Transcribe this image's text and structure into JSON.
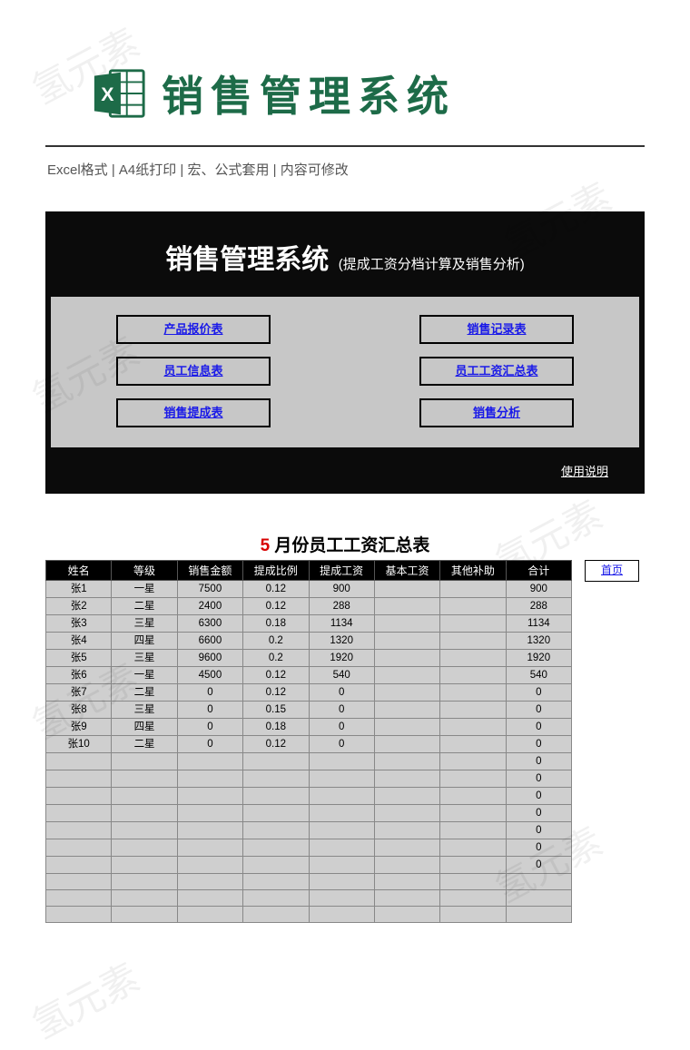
{
  "watermark_text": "氢元素",
  "header": {
    "title": "销售管理系统",
    "features": "Excel格式 |  A4纸打印 | 宏、公式套用 | 内容可修改"
  },
  "panel1": {
    "title": "销售管理系统",
    "subtitle": "(提成工资分档计算及销售分析)",
    "buttons": [
      "产品报价表",
      "销售记录表",
      "员工信息表",
      "员工工资汇总表",
      "销售提成表",
      "销售分析"
    ],
    "usage": "使用说明"
  },
  "panel2": {
    "month": "5",
    "title_rest": " 月份员工工资汇总表",
    "home": "首页",
    "columns": [
      "姓名",
      "等级",
      "销售金额",
      "提成比例",
      "提成工资",
      "基本工资",
      "其他补助",
      "合计"
    ],
    "rows": [
      {
        "c": [
          "张1",
          "一星",
          "7500",
          "0.12",
          "900",
          "",
          "",
          "900"
        ]
      },
      {
        "c": [
          "张2",
          "二星",
          "2400",
          "0.12",
          "288",
          "",
          "",
          "288"
        ]
      },
      {
        "c": [
          "张3",
          "三星",
          "6300",
          "0.18",
          "1134",
          "",
          "",
          "1134"
        ]
      },
      {
        "c": [
          "张4",
          "四星",
          "6600",
          "0.2",
          "1320",
          "",
          "",
          "1320"
        ]
      },
      {
        "c": [
          "张5",
          "三星",
          "9600",
          "0.2",
          "1920",
          "",
          "",
          "1920"
        ]
      },
      {
        "c": [
          "张6",
          "一星",
          "4500",
          "0.12",
          "540",
          "",
          "",
          "540"
        ]
      },
      {
        "c": [
          "张7",
          "二星",
          "0",
          "0.12",
          "0",
          "",
          "",
          "0"
        ]
      },
      {
        "c": [
          "张8",
          "三星",
          "0",
          "0.15",
          "0",
          "",
          "",
          "0"
        ]
      },
      {
        "c": [
          "张9",
          "四星",
          "0",
          "0.18",
          "0",
          "",
          "",
          "0"
        ]
      },
      {
        "c": [
          "张10",
          "二星",
          "0",
          "0.12",
          "0",
          "",
          "",
          "0"
        ]
      },
      {
        "c": [
          "",
          "",
          "",
          "",
          "",
          "",
          "",
          "0"
        ]
      },
      {
        "c": [
          "",
          "",
          "",
          "",
          "",
          "",
          "",
          "0"
        ]
      },
      {
        "c": [
          "",
          "",
          "",
          "",
          "",
          "",
          "",
          "0"
        ]
      },
      {
        "c": [
          "",
          "",
          "",
          "",
          "",
          "",
          "",
          "0"
        ]
      },
      {
        "c": [
          "",
          "",
          "",
          "",
          "",
          "",
          "",
          "0"
        ]
      },
      {
        "c": [
          "",
          "",
          "",
          "",
          "",
          "",
          "",
          "0"
        ]
      },
      {
        "c": [
          "",
          "",
          "",
          "",
          "",
          "",
          "",
          "0"
        ]
      },
      {
        "c": [
          "",
          "",
          "",
          "",
          "",
          "",
          "",
          ""
        ]
      },
      {
        "c": [
          "",
          "",
          "",
          "",
          "",
          "",
          "",
          ""
        ]
      },
      {
        "c": [
          "",
          "",
          "",
          "",
          "",
          "",
          "",
          ""
        ]
      }
    ]
  }
}
